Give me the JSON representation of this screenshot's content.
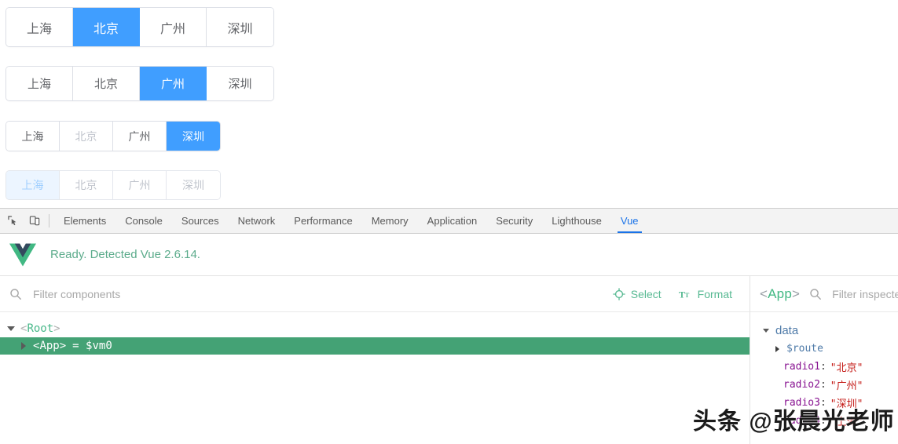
{
  "app": {
    "cities": [
      "上海",
      "北京",
      "广州",
      "深圳"
    ],
    "groups": [
      {
        "name": "radio-group-large",
        "size": "large",
        "selected": "北京",
        "group_disabled": false,
        "disabled_items": []
      },
      {
        "name": "radio-group-medium",
        "size": "medium",
        "selected": "广州",
        "group_disabled": false,
        "disabled_items": []
      },
      {
        "name": "radio-group-small",
        "size": "small",
        "selected": "深圳",
        "group_disabled": false,
        "disabled_items": [
          "北京"
        ]
      },
      {
        "name": "radio-group-disabled",
        "size": "small",
        "selected": "上海",
        "group_disabled": true,
        "disabled_items": [
          "上海",
          "北京",
          "广州",
          "深圳"
        ]
      }
    ]
  },
  "devtools": {
    "icons": {
      "inspect": "inspect-element-icon",
      "device": "device-toolbar-icon"
    },
    "tabs": [
      {
        "label": "Elements",
        "selected": false
      },
      {
        "label": "Console",
        "selected": false
      },
      {
        "label": "Sources",
        "selected": false
      },
      {
        "label": "Network",
        "selected": false
      },
      {
        "label": "Performance",
        "selected": false
      },
      {
        "label": "Memory",
        "selected": false
      },
      {
        "label": "Application",
        "selected": false
      },
      {
        "label": "Security",
        "selected": false
      },
      {
        "label": "Lighthouse",
        "selected": false
      },
      {
        "label": "Vue",
        "selected": true
      }
    ],
    "accent_color": "#1a73e8"
  },
  "vue_panel": {
    "banner_text": "Ready. Detected Vue 2.6.14.",
    "banner_color": "#5bab8b",
    "logo": "vue-logo-icon",
    "components": {
      "filter_placeholder": "Filter components",
      "filter_value": "",
      "actions": [
        {
          "label": "Select",
          "icon": "target-select-icon"
        },
        {
          "label": "Format",
          "icon": "text-format-icon"
        }
      ],
      "tree": [
        {
          "label": "Root",
          "expanded": true,
          "selected": false,
          "suffix": "",
          "depth": 0
        },
        {
          "label": "App",
          "expanded": false,
          "selected": true,
          "suffix": "= $vm0",
          "depth": 1
        }
      ]
    },
    "inspector": {
      "title_open": "<",
      "title_name": "App",
      "title_close": ">",
      "filter_placeholder": "Filter inspecte",
      "filter_value": "",
      "sections": [
        {
          "name": "data",
          "expanded": true,
          "rows": [
            {
              "key": "$route",
              "kind": "object",
              "expanded": false,
              "value": ""
            },
            {
              "key": "radio1",
              "kind": "string",
              "value": "\"北京\""
            },
            {
              "key": "radio2",
              "kind": "string",
              "value": "\"广州\""
            },
            {
              "key": "radio3",
              "kind": "string",
              "value": "\"深圳\""
            },
            {
              "key": "radio4",
              "kind": "string",
              "value": "\"上海\""
            }
          ]
        }
      ]
    },
    "accent_green": "#42b883"
  },
  "watermark": {
    "text": "头条 @张晨光老师"
  }
}
